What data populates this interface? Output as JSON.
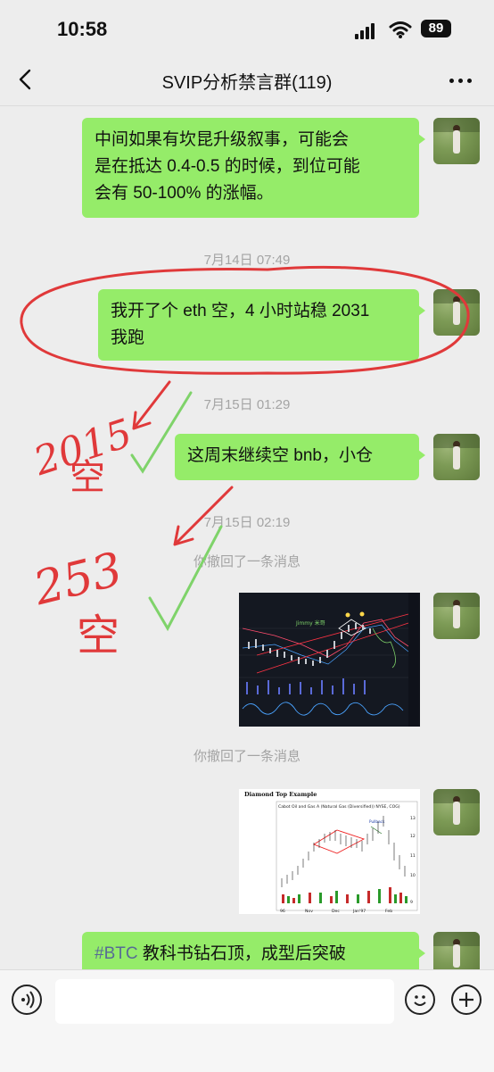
{
  "status": {
    "time": "10:58",
    "battery": "89"
  },
  "header": {
    "title": "SVIP分析禁言群(119)"
  },
  "messages": [
    {
      "type": "text",
      "text_line1": "中间如果有坎昆升级叙事，可能会",
      "text_line2": "是在抵达 0.4-0.5 的时候，到位可能",
      "text_line3": "会有 50-100% 的涨幅。"
    },
    {
      "type": "timestamp",
      "text": "7月14日 07:49"
    },
    {
      "type": "text",
      "text_line1": "我开了个 eth 空，4 小时站稳 2031",
      "text_line2": "我跑"
    },
    {
      "type": "timestamp",
      "text": "7月15日 01:29"
    },
    {
      "type": "text",
      "text": "这周末继续空 bnb，小仓"
    },
    {
      "type": "timestamp",
      "text": "7月15日 02:19"
    },
    {
      "type": "system",
      "text": "你撤回了一条消息"
    },
    {
      "type": "image",
      "caption": "Jimmy 米哥"
    },
    {
      "type": "system",
      "text": "你撤回了一条消息"
    },
    {
      "type": "image",
      "title": "Diamond Top Example",
      "subtitle": "Cabot Oil and Gas A (Natural Gas (Diversified)) NYSE, COG)",
      "callout": "Pullback",
      "x_labels": [
        "96",
        "Nov",
        "Dec",
        "Jan'97",
        "Feb"
      ],
      "y_labels": [
        "13",
        "12",
        "11",
        "10",
        "9"
      ]
    },
    {
      "type": "text",
      "hashtag": "#BTC",
      "text": " 教科书钻石顶，成型后突破"
    }
  ],
  "handwriting": {
    "note1_num": "2015",
    "note1_char": "空",
    "note2_num": "253",
    "note2_char": "空"
  },
  "colors": {
    "bubble": "#95ec69",
    "background": "#ededed",
    "annotation": "#e0393a",
    "check": "#7fd36a"
  }
}
